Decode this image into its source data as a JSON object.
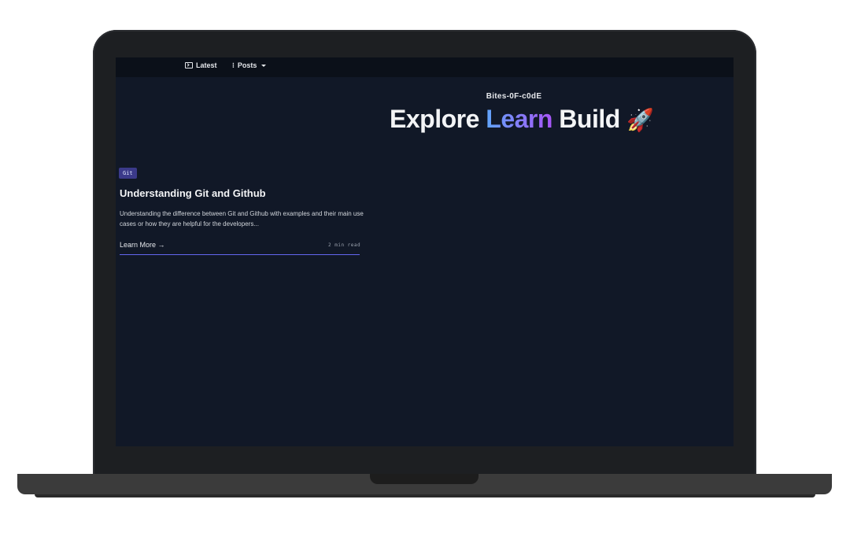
{
  "nav": {
    "latest_label": "Latest",
    "posts_label": "Posts"
  },
  "hero": {
    "site_name": "Bites-0F-c0dE",
    "word1": "Explore",
    "word2": "Learn",
    "word3": "Build",
    "emoji": "🚀"
  },
  "card": {
    "tag": "Git",
    "title": "Understanding Git and Github",
    "description": "Understanding the difference between Git and Github with examples and their main use cases or how they are helpful for the developers...",
    "link_label": "Learn More →",
    "read_time": "2 min read"
  },
  "icons": [
    "terminal-icon",
    "list-icon",
    "caret-down-icon",
    "rocket-icon"
  ],
  "colors": {
    "background": "#111827",
    "accent": "#6366f1",
    "tag_bg": "#3b3a8a"
  }
}
